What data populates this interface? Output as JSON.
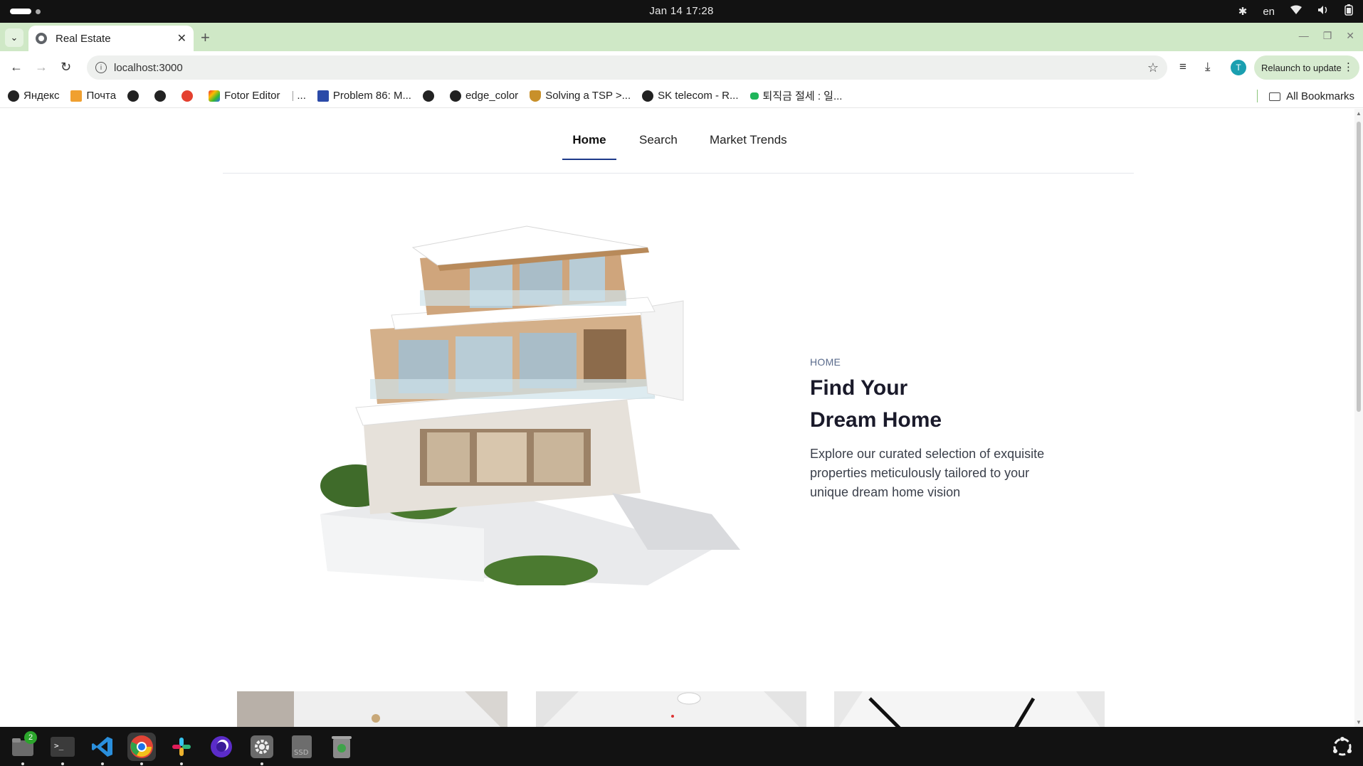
{
  "os": {
    "clock": "Jan 14  17:28",
    "lang": "en"
  },
  "browser": {
    "tab_title": "Real Estate",
    "url": "localhost:3000",
    "relaunch_label": "Relaunch to update",
    "avatar_letter": "T",
    "bookmarks": [
      {
        "label": "Яндекс",
        "icon": "yandex-icon"
      },
      {
        "label": "Почта",
        "icon": "mail-icon"
      },
      {
        "label": "",
        "icon": "globe-icon"
      },
      {
        "label": "",
        "icon": "globe-icon"
      },
      {
        "label": "",
        "icon": "chart-icon"
      },
      {
        "label": "Fotor Editor",
        "icon": "fotor-icon"
      },
      {
        "label": "...",
        "icon": ""
      },
      {
        "label": "Problem 86: M...",
        "icon": "usaco-icon"
      },
      {
        "label": "",
        "icon": "globe-icon"
      },
      {
        "label": "edge_color",
        "icon": "github-icon"
      },
      {
        "label": "Solving a TSP >...",
        "icon": "shield-icon"
      },
      {
        "label": "SK telecom - R...",
        "icon": "globe-icon"
      },
      {
        "label": "퇴직금 절세 : 일...",
        "icon": "green-icon"
      }
    ],
    "all_bookmarks_label": "All Bookmarks"
  },
  "site": {
    "nav": [
      "Home",
      "Search",
      "Market Trends"
    ],
    "active_nav": "Home",
    "hero": {
      "eyebrow": "HOME",
      "title": "Find Your Dream Home",
      "description": "Explore our curated selection of exquisite properties meticulously tailored to your unique dream home vision"
    }
  },
  "taskbar": {
    "files_badge": "2",
    "apps": [
      "files-icon",
      "terminal-icon",
      "vscode-icon",
      "chrome-icon",
      "slack-icon",
      "firefox-dev-icon",
      "settings-icon",
      "ssd-icon",
      "trash-icon"
    ]
  }
}
